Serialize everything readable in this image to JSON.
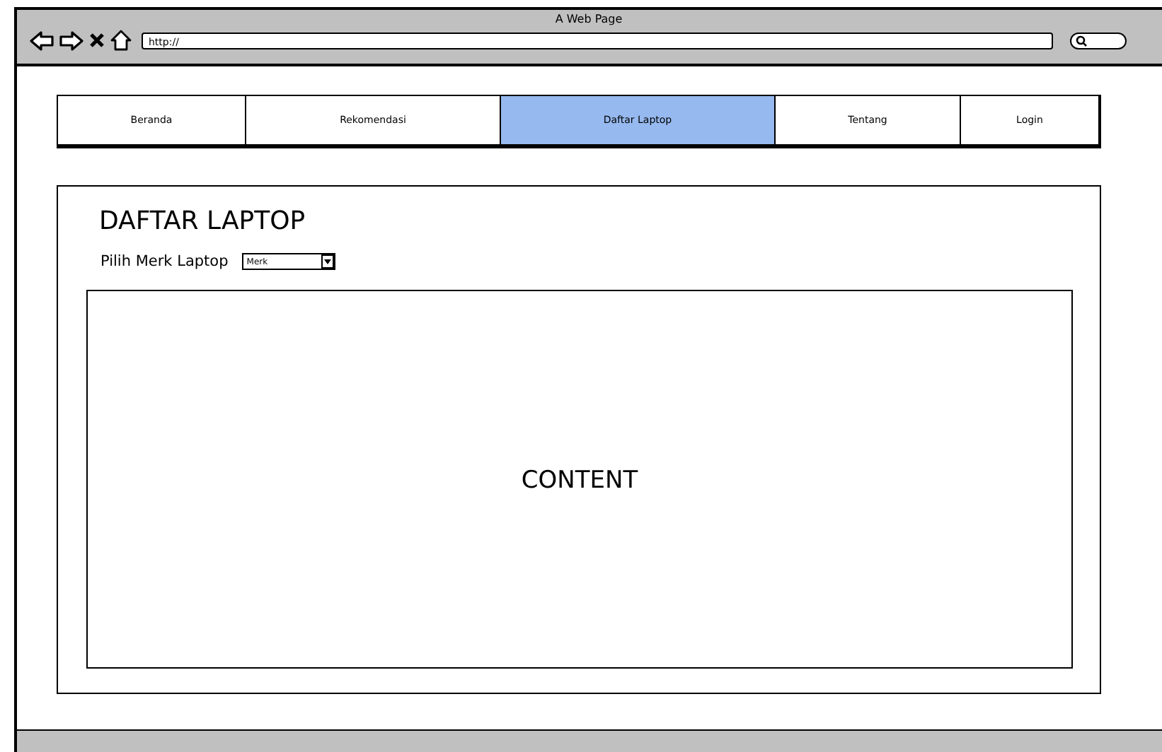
{
  "window": {
    "title": "A Web Page",
    "url": "http://"
  },
  "tabs": [
    {
      "label": "Beranda",
      "selected": false
    },
    {
      "label": "Rekomendasi",
      "selected": false
    },
    {
      "label": "Daftar Laptop",
      "selected": true
    },
    {
      "label": "Tentang",
      "selected": false
    },
    {
      "label": "Login",
      "selected": false
    }
  ],
  "page": {
    "heading": "DAFTAR LAPTOP",
    "filter_label": "Pilih Merk Laptop",
    "dropdown_value": "Merk",
    "content": "CONTENT"
  }
}
